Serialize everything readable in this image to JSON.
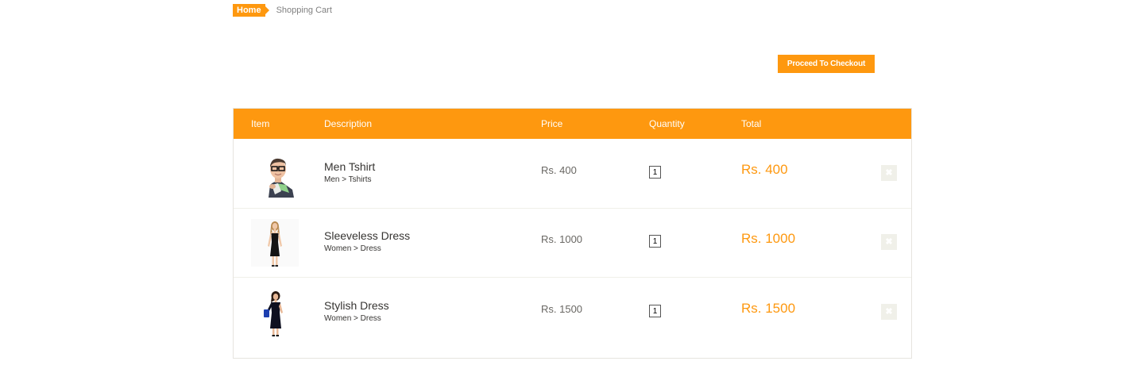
{
  "breadcrumb": {
    "home": "Home",
    "current": "Shopping Cart"
  },
  "checkout_button": "Proceed To Checkout",
  "table": {
    "headers": {
      "item": "Item",
      "description": "Description",
      "price": "Price",
      "quantity": "Quantity",
      "total": "Total"
    },
    "rows": [
      {
        "name": "Men Tshirt",
        "category": "Men > Tshirts",
        "price": "Rs. 400",
        "quantity": "1",
        "total": "Rs. 400",
        "delete_icon": "close-icon"
      },
      {
        "name": "Sleeveless Dress",
        "category": "Women > Dress",
        "price": "Rs. 1000",
        "quantity": "1",
        "total": "Rs. 1000",
        "delete_icon": "close-icon"
      },
      {
        "name": "Stylish Dress",
        "category": "Women > Dress",
        "price": "Rs. 1500",
        "quantity": "1",
        "total": "Rs. 1500",
        "delete_icon": "close-icon"
      }
    ]
  },
  "colors": {
    "accent": "#FE980F",
    "header_text": "#FFFFFF",
    "body_text": "#363432",
    "price_text": "#696763",
    "border": "#E6E4DF",
    "delete_bg": "#F0F0E9"
  }
}
